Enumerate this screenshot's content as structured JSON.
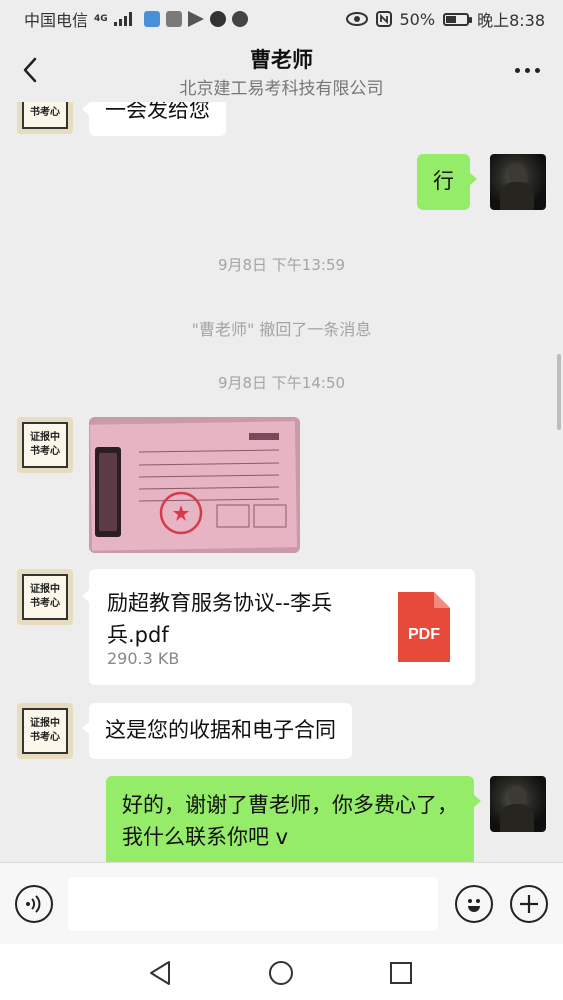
{
  "status_bar": {
    "carrier": "中国电信",
    "network": "4G",
    "battery": "50%",
    "battery_level": 0.5,
    "time": "晚上8:38"
  },
  "header": {
    "title": "曹老师",
    "subtitle": "北京建工易考科技有限公司"
  },
  "contact": {
    "avatar_seal_text": [
      "证报中",
      "书考心"
    ]
  },
  "messages": {
    "partial_incoming": "一会发给您",
    "reply_ok": "行",
    "timestamp_1": "9月8日 下午13:59",
    "recall_notice": "\"曹老师\" 撤回了一条消息",
    "timestamp_2": "9月8日 下午14:50",
    "file": {
      "name": "励超教育服务协议--李兵兵.pdf",
      "size": "290.3 KB",
      "type_label": "PDF"
    },
    "receipt_note": "这是您的收据和电子合同",
    "thanks_reply": "好的，谢谢了曹老师，你多费心了，我什么联系你吧 v"
  },
  "input_bar": {
    "placeholder": ""
  },
  "colors": {
    "outgoing_bubble": "#95ec69",
    "incoming_bubble": "#ffffff",
    "background": "#ededed",
    "pdf_red": "#e64a3b"
  }
}
